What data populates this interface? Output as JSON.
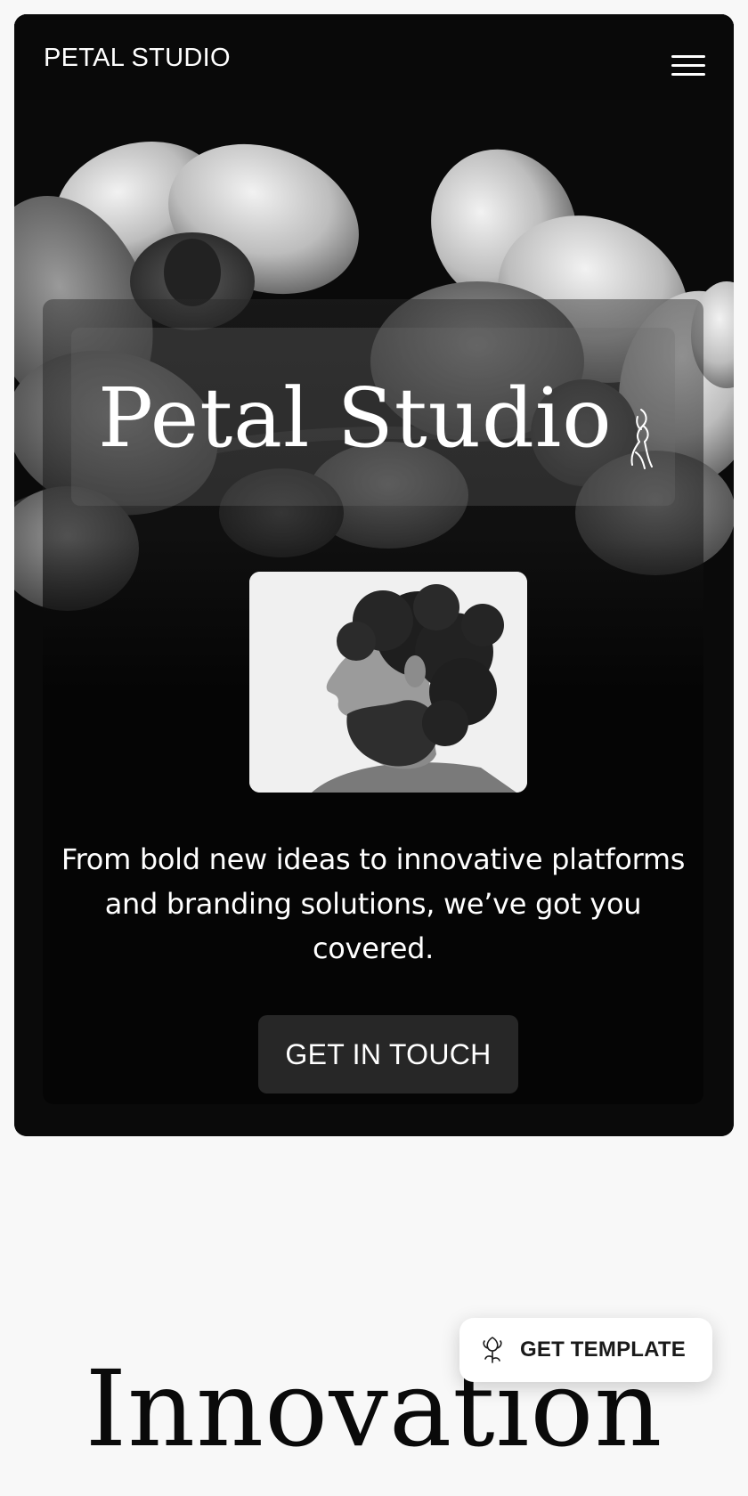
{
  "nav": {
    "brand": "PETAL STUDIO",
    "menu_icon": "hamburger-menu-icon"
  },
  "hero": {
    "title": "Petal Studio",
    "logo_icon": "flower-line-icon",
    "tagline": "From bold new ideas to innovative platforms and branding solutions, we’ve got you covered.",
    "cta_label": "GET IN TOUCH"
  },
  "section": {
    "heading": "Innovation"
  },
  "floating_button": {
    "label": "GET TEMPLATE",
    "icon": "flower-line-icon"
  },
  "colors": {
    "page_background": "#f8f8f8",
    "hero_background": "#0a0a0a",
    "cta_background": "#272727",
    "text_light": "#ffffff",
    "text_dark": "#0a0a0a"
  }
}
